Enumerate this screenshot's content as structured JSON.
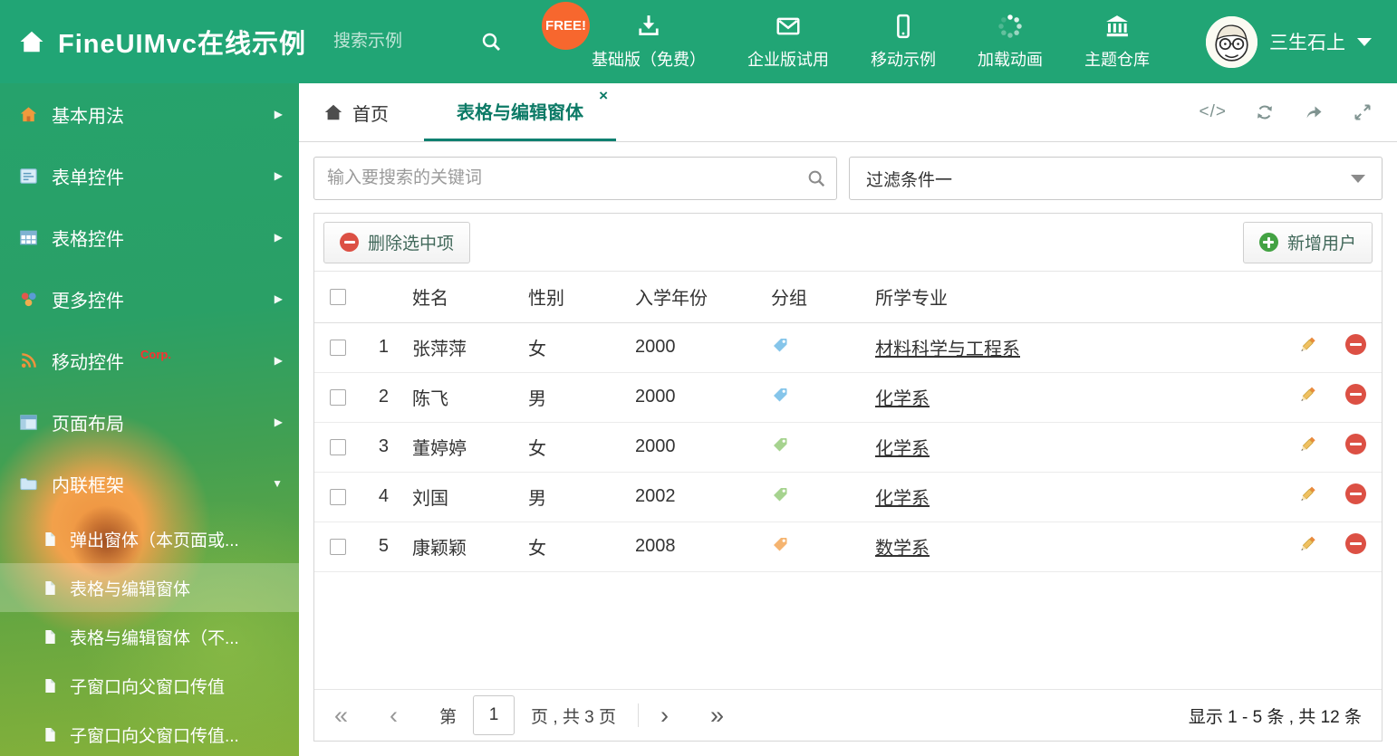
{
  "header": {
    "title": "FineUIMvc在线示例",
    "search_placeholder": "搜索示例",
    "free_badge": "FREE!",
    "nav": [
      {
        "label": "基础版（免费）",
        "icon": "download-icon"
      },
      {
        "label": "企业版试用",
        "icon": "envelope-icon"
      },
      {
        "label": "移动示例",
        "icon": "mobile-icon"
      },
      {
        "label": "加载动画",
        "icon": "spinner-icon"
      },
      {
        "label": "主题仓库",
        "icon": "bank-icon"
      }
    ],
    "user_name": "三生石上"
  },
  "sidebar": {
    "items": [
      {
        "label": "基本用法",
        "icon": "home-icon"
      },
      {
        "label": "表单控件",
        "icon": "form-icon"
      },
      {
        "label": "表格控件",
        "icon": "table-icon"
      },
      {
        "label": "更多控件",
        "icon": "more-controls-icon"
      },
      {
        "label": "移动控件",
        "icon": "mobile-signal-icon",
        "badge": "Corp."
      },
      {
        "label": "页面布局",
        "icon": "layout-icon"
      },
      {
        "label": "内联框架",
        "icon": "folder-icon"
      }
    ],
    "subitems": [
      {
        "label": "弹出窗体（本页面或..."
      },
      {
        "label": "表格与编辑窗体",
        "active": true
      },
      {
        "label": "表格与编辑窗体（不..."
      },
      {
        "label": "子窗口向父窗口传值"
      },
      {
        "label": "子窗口向父窗口传值..."
      }
    ]
  },
  "tabs": {
    "home": "首页",
    "active": "表格与编辑窗体"
  },
  "content": {
    "search_placeholder": "输入要搜索的关键词",
    "filter_value": "过滤条件一",
    "toolbar": {
      "delete_label": "删除选中项",
      "add_label": "新增用户"
    },
    "table": {
      "headers": {
        "name": "姓名",
        "gender": "性别",
        "year": "入学年份",
        "group": "分组",
        "major": "所学专业"
      },
      "rows": [
        {
          "num": "1",
          "name": "张萍萍",
          "gender": "女",
          "year": "2000",
          "tag_color": "#85c5ea",
          "major": "材料科学与工程系"
        },
        {
          "num": "2",
          "name": "陈飞",
          "gender": "男",
          "year": "2000",
          "tag_color": "#85c5ea",
          "major": "化学系"
        },
        {
          "num": "3",
          "name": "董婷婷",
          "gender": "女",
          "year": "2000",
          "tag_color": "#a6d38f",
          "major": "化学系"
        },
        {
          "num": "4",
          "name": "刘国",
          "gender": "男",
          "year": "2002",
          "tag_color": "#a6d38f",
          "major": "化学系"
        },
        {
          "num": "5",
          "name": "康颖颖",
          "gender": "女",
          "year": "2008",
          "tag_color": "#f5b470",
          "major": "数学系"
        }
      ]
    },
    "pagination": {
      "page_label": "第",
      "page_value": "1",
      "pages_label": "页 , 共 3 页",
      "summary": "显示 1 - 5 条 , 共 12 条"
    }
  },
  "glyphs": {
    "tab_close": "×",
    "code": "</>",
    "arrow_right": "▶",
    "arrow_down": "▼",
    "pg_first": "«",
    "pg_prev": "‹",
    "pg_next": "›",
    "pg_last": "»"
  },
  "colors": {
    "header_green": "#21a575",
    "active_tab_teal": "#0f8070",
    "delete_red": "#dc5044",
    "add_green": "#43a243"
  }
}
